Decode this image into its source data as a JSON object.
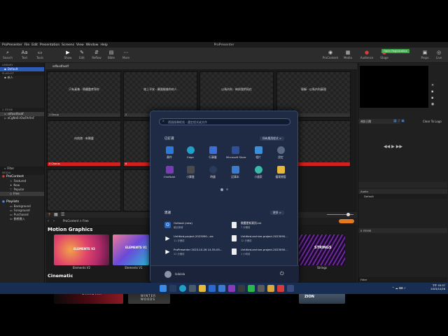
{
  "menubar": {
    "items": [
      "ProPresenter",
      "File",
      "Edit",
      "Presentation",
      "Screens",
      "View",
      "Window",
      "Help"
    ],
    "title": "ProPresenter"
  },
  "toolbar": {
    "left": [
      {
        "label": "Search",
        "icon": "search-icon"
      },
      {
        "label": "Text",
        "icon": "text-icon"
      },
      {
        "label": "Tools",
        "icon": "tools-icon"
      }
    ],
    "center": [
      {
        "label": "Show",
        "icon": "play-icon"
      },
      {
        "label": "Edit",
        "icon": "pencil-icon"
      },
      {
        "label": "Reflow",
        "icon": "reflow-icon"
      },
      {
        "label": "Bible",
        "icon": "book-icon"
      },
      {
        "label": "More",
        "icon": "more-icon"
      }
    ],
    "right": [
      {
        "label": "ProContent",
        "icon": "procontent-icon"
      },
      {
        "label": "Media",
        "icon": "media-icon"
      },
      {
        "label": "Audience",
        "icon": "record-icon"
      },
      {
        "label": "Stage",
        "icon": "stage-icon"
      }
    ],
    "far_right": [
      {
        "label": "Props",
        "icon": "props-icon"
      },
      {
        "label": "Live",
        "icon": "live-icon"
      }
    ],
    "green_button": "Open Registration"
  },
  "library": {
    "header": "LIBRARY",
    "item": "Default",
    "playlist_header": "PLAYLIST",
    "playlist_item": "新人"
  },
  "items": {
    "header": "2 ITEMS",
    "rows": [
      "sdfasdfasdf",
      "eCgNn6-iOwFAr0nF"
    ]
  },
  "filter": "Filter",
  "media": {
    "header": "MEDIA",
    "procontent": "ProContent",
    "featured": "Featured",
    "new": "New",
    "popular": "Popular",
    "free": "Free",
    "playlists": "Playlists",
    "bg": "Background",
    "fg": "Foreground",
    "purchased": "Purchased",
    "import": "動態匯入"
  },
  "slides": {
    "header": "sdfasdfasdf",
    "list": [
      {
        "text": "只有真善 · 德權盡孝拜你",
        "label": "1 Group",
        "red": false
      },
      {
        "text": "地上平安 · 願我能像你的人",
        "label": "2",
        "red": false
      },
      {
        "text": "以馬內利 · 神與我們同在",
        "label": "3",
        "red": false
      },
      {
        "text": "耶穌 · 以馬內利真理",
        "label": "4",
        "red": false
      },
      {
        "text": "向前跑 · 有屬靈",
        "label": "5 Chorus",
        "red": true
      },
      {
        "text": "",
        "label": "6",
        "red": true
      },
      {
        "text": "",
        "label": "7",
        "red": false
      },
      {
        "text": "",
        "label": "8",
        "red": false
      }
    ]
  },
  "breadcrumb": "ProContent  >  Free",
  "sections": {
    "motion": "Motion Graphics",
    "cinematic": "Cinematic"
  },
  "thumbs": [
    {
      "caption": "Elements V2",
      "overlay": "ELEMENTS V2"
    },
    {
      "caption": "Elements V1",
      "overlay": "ELEMENTS V1"
    },
    {
      "caption": "Strings",
      "overlay": "STRINGS"
    }
  ],
  "cine": [
    "CHROMA",
    "WINTER WOODS",
    "ZION"
  ],
  "right": {
    "clear": "Clear To Logo",
    "audio": "Audio",
    "default": "Default",
    "items": "0 ITEMS",
    "filter": "Filter",
    "dropdown": "視訊已關"
  },
  "start": {
    "search_placeholder": "透過搜尋框找 - 選定程式或文件",
    "pinned_title": "已釘選",
    "all_apps": "所有應用程式 >",
    "apps": [
      {
        "label": "郵件",
        "color": "#2a78d8",
        "icon": "mail-icon"
      },
      {
        "label": "Edge",
        "color": "#1fa0c8",
        "icon": "edge-icon"
      },
      {
        "label": "行事曆",
        "color": "#3a6ed8",
        "icon": "calendar-icon"
      },
      {
        "label": "Microsoft Store",
        "color": "#2f4f9a",
        "icon": "store-icon"
      },
      {
        "label": "相片",
        "color": "#3b8fd8",
        "icon": "photos-icon"
      },
      {
        "label": "設定",
        "color": "#5a6a80",
        "icon": "settings-icon"
      },
      {
        "label": "OneNote",
        "color": "#7a3ab8",
        "icon": "onenote-icon"
      },
      {
        "label": "小算盤",
        "color": "#4a4a4a",
        "icon": "calculator-icon"
      },
      {
        "label": "時鐘",
        "color": "#2a3a5a",
        "icon": "clock-icon"
      },
      {
        "label": "記事本",
        "color": "#3a7ad0",
        "icon": "notepad-icon"
      },
      {
        "label": "小畫家",
        "color": "#3ab8a8",
        "icon": "paint-icon"
      },
      {
        "label": "檔案總管",
        "color": "#e8b83a",
        "icon": "folder-icon"
      }
    ],
    "rec_title": "建議",
    "more": "更多 >",
    "recommended": [
      {
        "name": "Outlook (new)",
        "time": "最近新增",
        "icon": "outlook-icon"
      },
      {
        "name": "軟體更新資訊.txt",
        "time": "7 分鐘前",
        "icon": "file-icon"
      },
      {
        "name": "Untitled-project-2023090...aic",
        "time": "11 分鐘前",
        "icon": "video-icon"
      },
      {
        "name": "Untitled-archive-project-2023090...",
        "time": "12 分鐘前",
        "icon": "file-icon"
      },
      {
        "name": "ProPresenter 2023-10-26 14-55-05...",
        "time": "22 分鐘前",
        "icon": "video-icon"
      },
      {
        "name": "Untitled-archive-project-2023090...",
        "time": "1 小時前",
        "icon": "file-icon"
      }
    ],
    "user": "lalalala"
  },
  "taskbar": {
    "time": "下午 03:37",
    "date": "2023/10/26"
  }
}
